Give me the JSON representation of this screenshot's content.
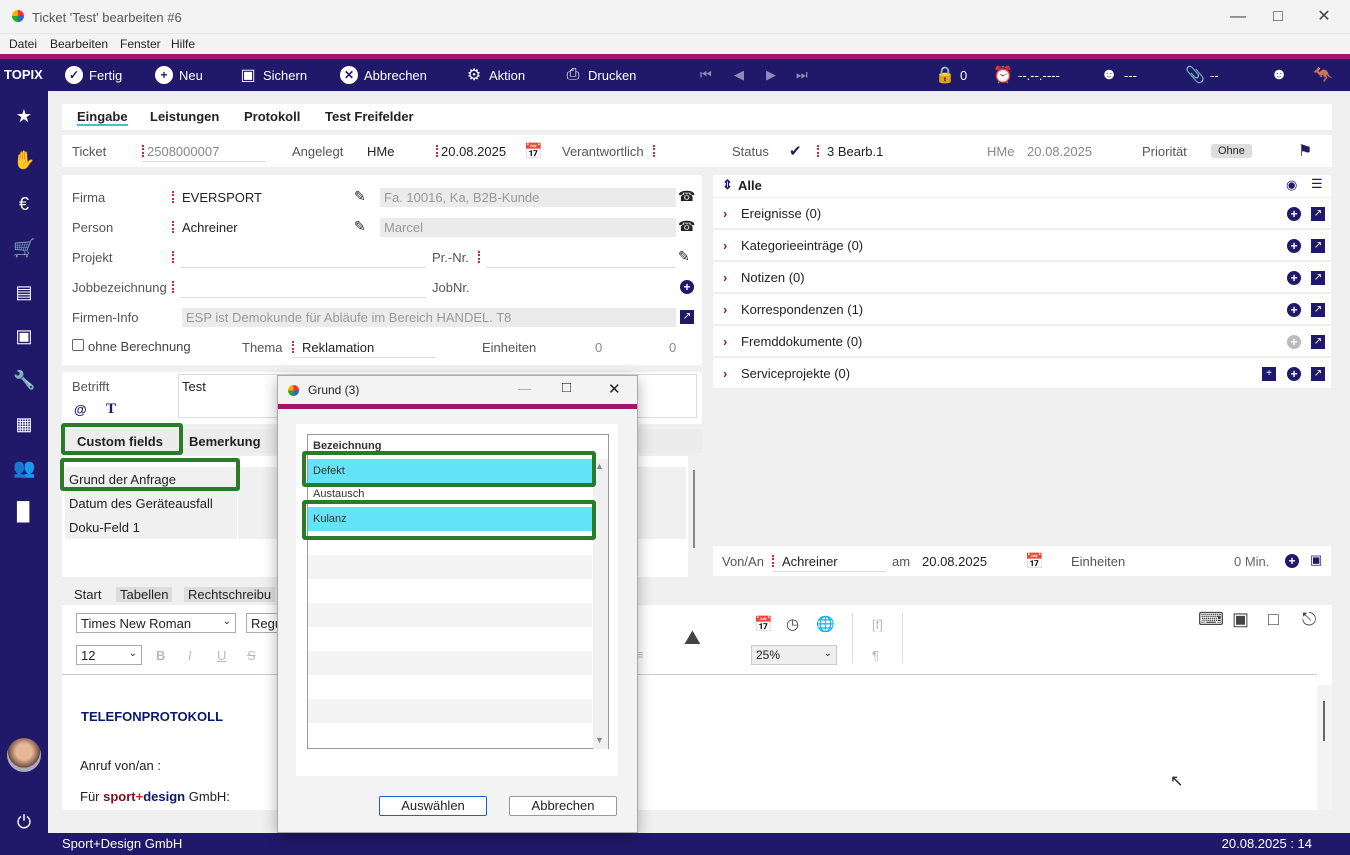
{
  "window": {
    "title": "Ticket 'Test' bearbeiten #6"
  },
  "menu": [
    "Datei",
    "Bearbeiten",
    "Fenster",
    "Hilfe"
  ],
  "brand": "TOPIX",
  "toolbar": {
    "fertig": "Fertig",
    "neu": "Neu",
    "sichern": "Sichern",
    "abbrechen": "Abbrechen",
    "aktion": "Aktion",
    "drucken": "Drucken",
    "lock_count": "0",
    "timer": "--.--.----",
    "user": "---",
    "attach": "--"
  },
  "tabs": [
    "Eingabe",
    "Leistungen",
    "Protokoll",
    "Test Freifelder"
  ],
  "ticket": {
    "label": "Ticket",
    "number": "2508000007",
    "angelegt_label": "Angelegt",
    "angelegt_user": "HMe",
    "angelegt_date": "20.08.2025",
    "verantwortlich_label": "Verantwortlich",
    "status_label": "Status",
    "status_value": "3 Bearb.1",
    "status_user": "HMe",
    "status_date": "20.08.2025",
    "prioritaet_label": "Priorität",
    "prioritaet_value": "Ohne"
  },
  "form": {
    "firma_label": "Firma",
    "firma_value": "EVERSPORT",
    "firma_info": "Fa. 10016, Ka, B2B-Kunde",
    "person_label": "Person",
    "person_value": "Achreiner",
    "person_first": "Marcel",
    "projekt_label": "Projekt",
    "prnr_label": "Pr.-Nr.",
    "jobbez_label": "Jobbezeichnung",
    "jobnr_label": "JobNr.",
    "fireninfo_label": "Firmen-Info",
    "fireninfo_value": "ESP ist Demokunde für Abläufe im Bereich HANDEL. T8",
    "ohne_berechnung": "ohne Berechnung",
    "thema_label": "Thema",
    "thema_value": "Reklamation",
    "einheiten_label": "Einheiten",
    "einheiten_a": "0",
    "einheiten_b": "0",
    "betrifft_label": "Betrifft",
    "betrifft_value": "Test"
  },
  "subtabs": {
    "custom": "Custom fields",
    "bemerkung": "Bemerkung"
  },
  "custom_fields": [
    "Grund der Anfrage",
    "Datum des Geräteausfall",
    "Doku-Feld 1"
  ],
  "right_panel": {
    "header": "Alle",
    "rows": [
      "Ereignisse (0)",
      "Kategorieeinträge (0)",
      "Notizen (0)",
      "Korrespondenzen (1)",
      "Fremddokumente (0)",
      "Serviceprojekte (0)"
    ]
  },
  "vonan": {
    "label": "Von/An",
    "value": "Achreiner",
    "am_label": "am",
    "am_value": "20.08.2025",
    "einheiten_label": "Einheiten",
    "einheiten_value": "0 Min."
  },
  "editor": {
    "tabs": [
      "Start",
      "Tabellen",
      "Rechtschreibu"
    ],
    "font": "Times New Roman",
    "style": "Regu",
    "size": "12",
    "zoom": "25%",
    "heading": "TELEFONPROTOKOLL",
    "line1": "Anruf von/an :",
    "line2_prefix": "Für",
    "line2_brand1": "sport",
    "line2_plus": "+",
    "line2_brand2": "design",
    "line2_suffix": "GmbH:"
  },
  "dialog": {
    "title": "Grund (3)",
    "column": "Bezeichnung",
    "items": [
      "Defekt",
      "Austausch",
      "Kulanz"
    ],
    "select": "Auswählen",
    "cancel": "Abbrechen"
  },
  "status": {
    "company": "Sport+Design GmbH",
    "datetime": "20.08.2025 : 14"
  },
  "colors": {
    "primary": "#20196a",
    "accent": "#a3146f",
    "highlight": "#62e3f7",
    "frame": "#2a7a2a"
  }
}
